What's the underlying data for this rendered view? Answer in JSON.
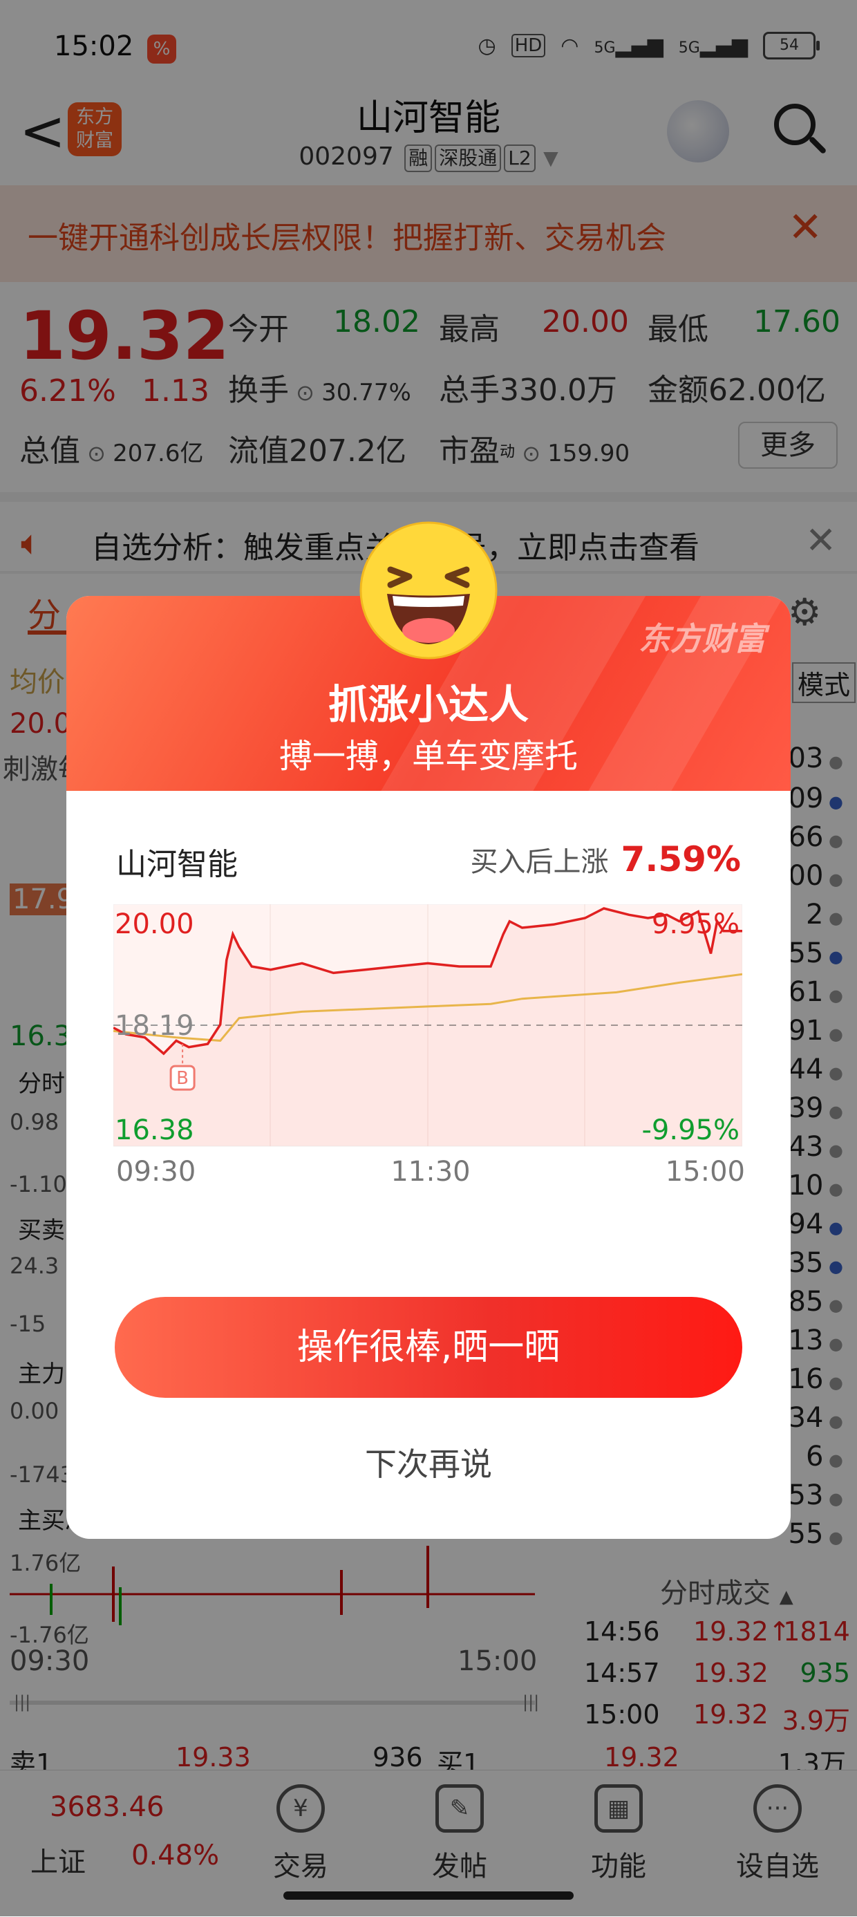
{
  "status_bar": {
    "time": "15:02",
    "app_icon": "%",
    "network": "5G",
    "battery": "54"
  },
  "header": {
    "back": "<",
    "logo_top": "东方",
    "logo_bottom": "财富",
    "stock_name": "山河智能",
    "stock_code": "002097",
    "tags": [
      "融",
      "深股通",
      "L2"
    ]
  },
  "promo": {
    "text": "一键开通科创成长层权限！把握打新、交易机会",
    "close": "✕"
  },
  "quote": {
    "price": "19.32",
    "change_pct": "6.21%",
    "change_amt": "1.13",
    "row1": [
      {
        "label": "今开",
        "value": "18.02"
      },
      {
        "label": "最高",
        "value": "20.00"
      },
      {
        "label": "最低",
        "value": "17.60"
      }
    ],
    "row2": [
      {
        "label": "换手",
        "value": "30.77%"
      },
      {
        "label": "总手",
        "value": "330.0万"
      },
      {
        "label": "金额",
        "value": "62.00亿"
      }
    ],
    "row3": [
      {
        "label": "总值",
        "value": "207.6亿"
      },
      {
        "label": "流值",
        "value": "207.2亿"
      },
      {
        "label": "市盈",
        "sup": "动",
        "value": "159.90"
      }
    ],
    "more": "更多"
  },
  "analysis": {
    "text": "自选分析：触发重点关注信号，立即点击查看",
    "close": "✕"
  },
  "background": {
    "tab": "分",
    "label_jiajia": "均价",
    "value_20": "20.0",
    "label_ji": "刺激每",
    "value_17_9": "17.9",
    "value_16_3": "16.3",
    "label_fenshi": "分时",
    "value_0_98": "0.98",
    "value_m1_10": "-1.10",
    "label_maimai": "买卖力",
    "value_24_3": "24.3",
    "value_m15": "-15",
    "label_zhuli": "主力意",
    "value_0_00": "0.00",
    "value_m1743": "-1743",
    "label_zhumai": "主买净",
    "vol_top": "1.76亿",
    "vol_bottom": "-1.76亿",
    "time_start": "09:30",
    "time_end": "15:00",
    "mode": "模式",
    "right_values": [
      "803",
      "809",
      "66",
      "200",
      "2",
      "55",
      "61",
      "291",
      "44",
      "39",
      "43",
      "10",
      "94",
      "35",
      "85",
      "13",
      "16",
      "434",
      "6",
      "553",
      "55"
    ],
    "fenshi_label": "分时成交",
    "trades": [
      {
        "time": "14:56",
        "price": "19.32↑",
        "vol": "1814"
      },
      {
        "time": "14:57",
        "price": "19.32",
        "vol": "935"
      },
      {
        "time": "15:00",
        "price": "19.32",
        "vol": "3.9万"
      }
    ],
    "sell1_label": "卖1",
    "sell1_price": "19.33",
    "sell1_vol": "936",
    "buy1_label": "买1",
    "buy1_price": "19.32",
    "buy1_vol": "1.3万"
  },
  "index": {
    "value": "3683.46",
    "name": "上证",
    "pct": "0.48%"
  },
  "nav": [
    {
      "label": "交易",
      "icon": "yen-icon"
    },
    {
      "label": "发帖",
      "icon": "edit-icon"
    },
    {
      "label": "功能",
      "icon": "grid-icon"
    },
    {
      "label": "设自选",
      "icon": "more-icon"
    }
  ],
  "modal": {
    "brand": "东方财富",
    "title": "抓涨小达人",
    "subtitle": "搏一搏，单车变摩托",
    "stock_name": "山河智能",
    "gain_label": "买入后上涨",
    "gain_value": "7.59%",
    "share_button": "操作很棒,晒一晒",
    "later_button": "下次再说"
  },
  "chart_data": {
    "type": "line",
    "y_top_label": "20.00",
    "y_mid_label": "18.19",
    "y_bottom_label": "16.38",
    "pct_top_label": "9.95%",
    "pct_bottom_label": "-9.95%",
    "x_labels": [
      "09:30",
      "11:30",
      "15:00"
    ],
    "buy_marker": "B",
    "ylim": [
      16.38,
      20.0
    ],
    "reference": 18.19,
    "series": [
      {
        "x": [
          0,
          0.02,
          0.05,
          0.08,
          0.1,
          0.12,
          0.15,
          0.17,
          0.18,
          0.19,
          0.2,
          0.22,
          0.25,
          0.3,
          0.35,
          0.4,
          0.45,
          0.5,
          0.55,
          0.6,
          0.62,
          0.63,
          0.65,
          0.7,
          0.75,
          0.78,
          0.8,
          0.82,
          0.85,
          0.88,
          0.9,
          0.93,
          0.95,
          0.96,
          0.97,
          1.0
        ],
        "values": [
          18.15,
          18.05,
          18.0,
          17.75,
          17.95,
          17.85,
          17.9,
          18.2,
          19.2,
          19.6,
          19.4,
          19.1,
          19.05,
          19.15,
          19.0,
          19.05,
          19.1,
          19.15,
          19.1,
          19.1,
          19.6,
          19.8,
          19.7,
          19.75,
          19.85,
          20.0,
          19.95,
          19.9,
          19.85,
          19.9,
          19.8,
          19.95,
          19.3,
          19.8,
          19.65,
          19.65
        ]
      },
      {
        "x": [
          0,
          0.1,
          0.17,
          0.2,
          0.3,
          0.5,
          0.6,
          0.65,
          0.8,
          0.9,
          1.0
        ],
        "values": [
          18.1,
          18.0,
          17.95,
          18.3,
          18.4,
          18.48,
          18.52,
          18.6,
          18.7,
          18.85,
          18.98
        ]
      }
    ]
  }
}
